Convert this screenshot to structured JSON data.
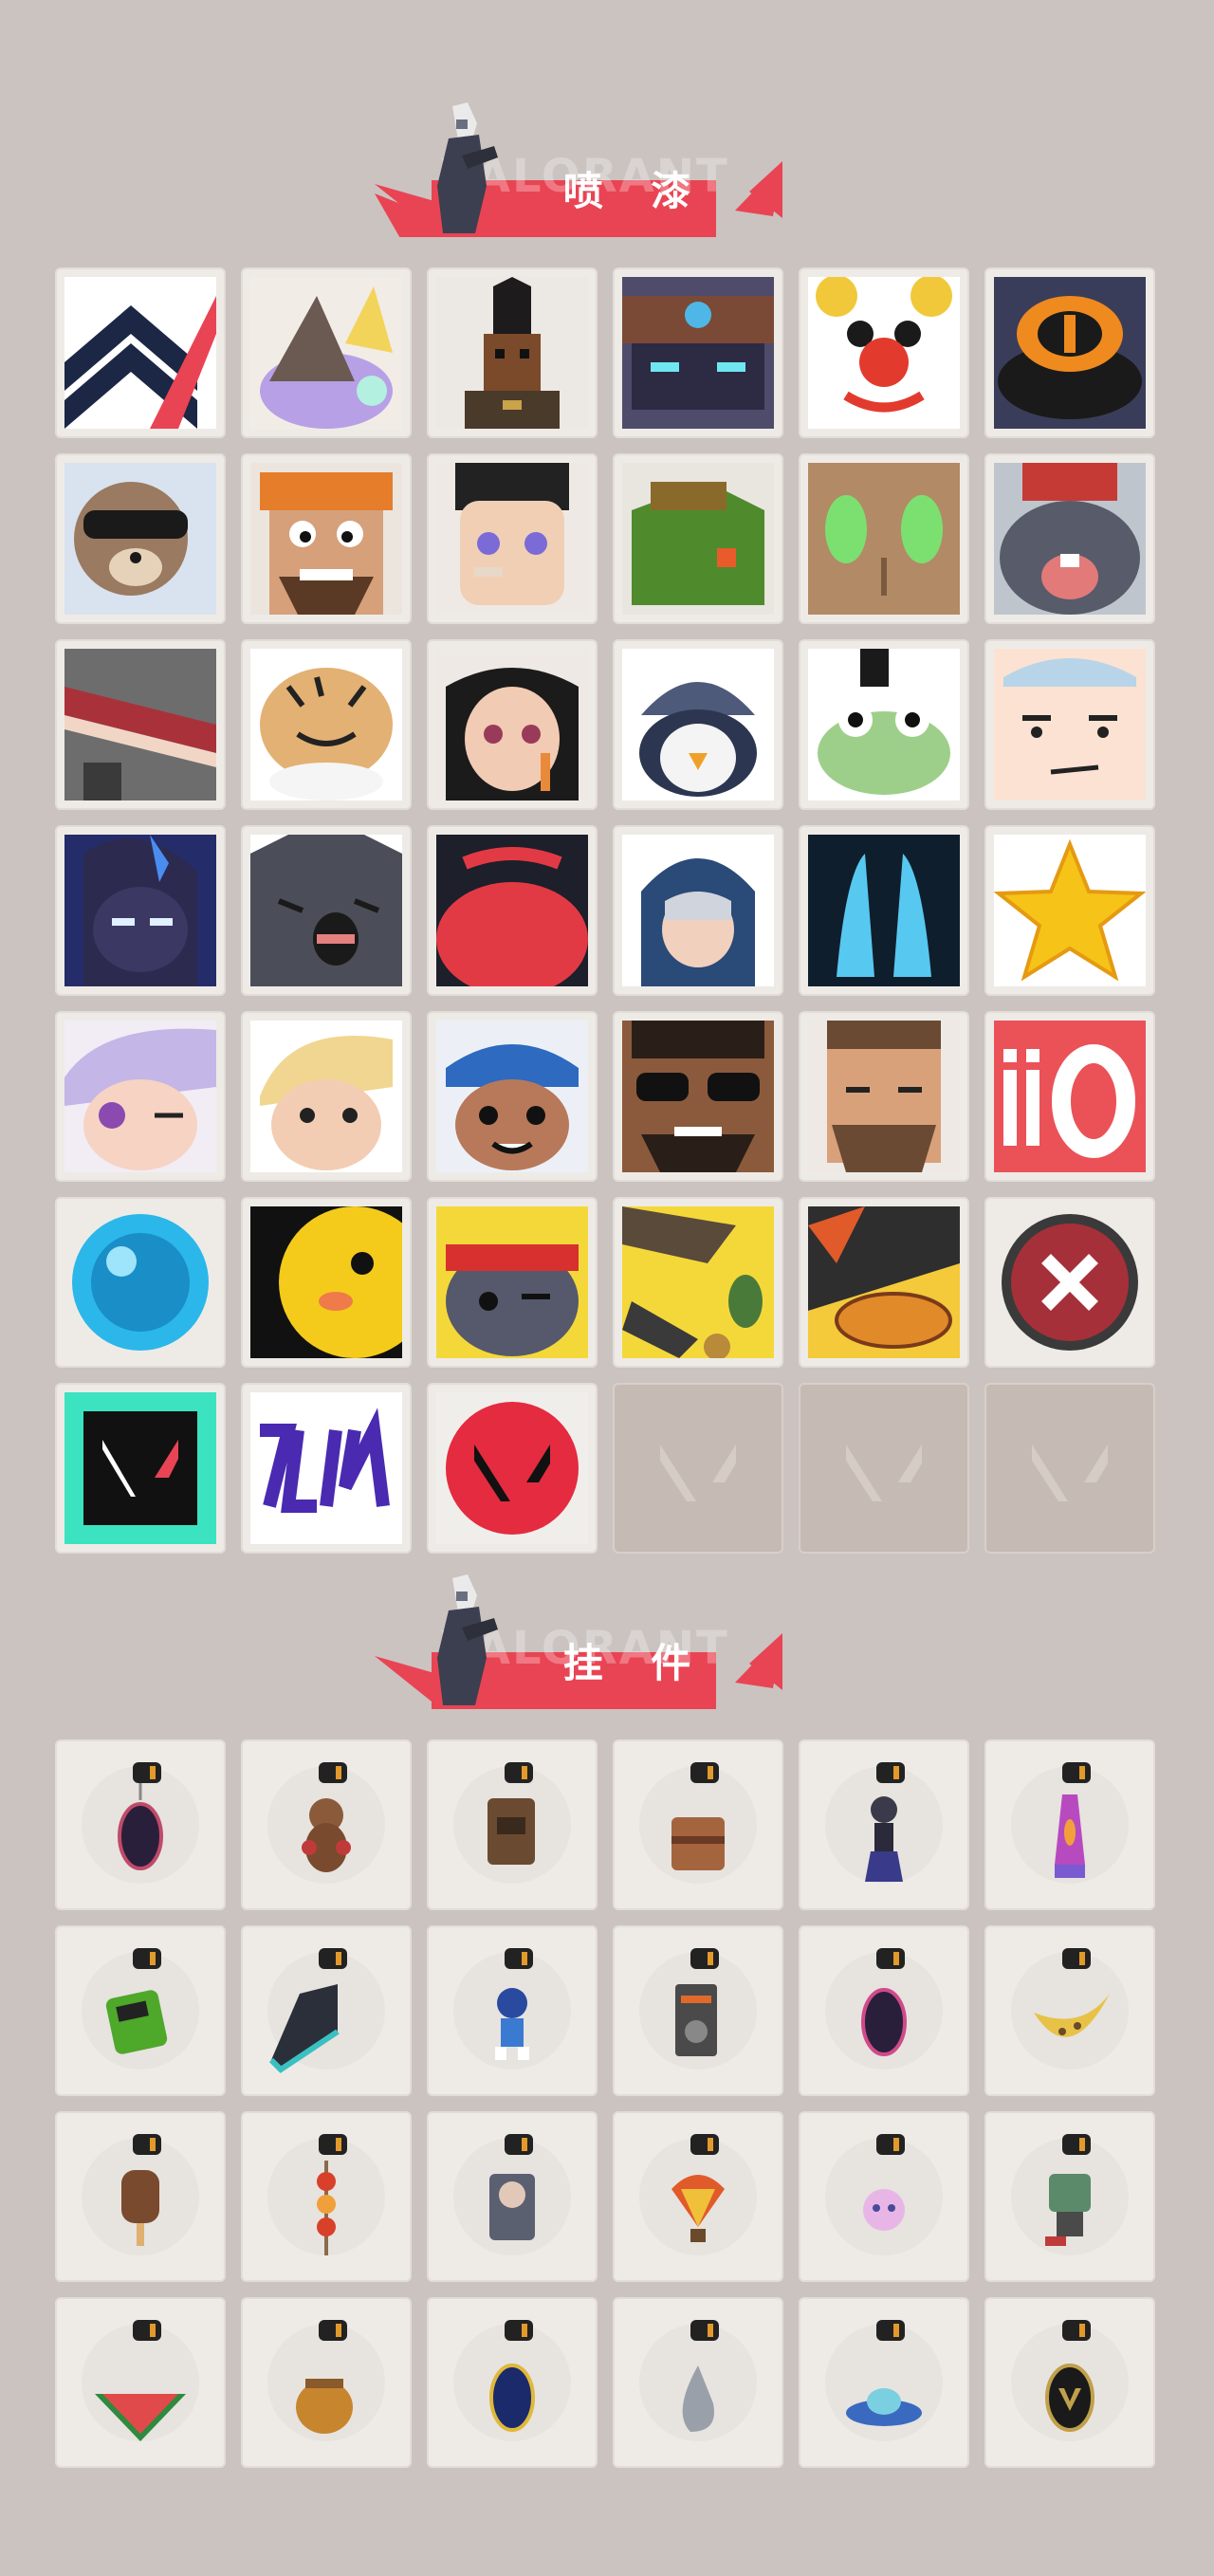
{
  "sections": [
    {
      "title": "喷 漆",
      "watermark": "VALORANT"
    },
    {
      "title": "挂 件",
      "watermark": "VALORANT"
    }
  ],
  "colors": {
    "background": "#cbc3c0",
    "accent": "#e94454",
    "tile": "#eeebe7",
    "empty_tile": "#c5bbb4"
  },
  "sprays": [
    "spray-chevron",
    "spray-horned-cat",
    "spray-pixel-agent",
    "spray-armored-robot",
    "spray-clown",
    "spray-orange-hat",
    "spray-raccoon-sunglasses",
    "spray-bearded-grin",
    "spray-bandaged-boy",
    "spray-green-crate",
    "spray-green-eyes",
    "spray-crying-creature",
    "spray-cake-slice",
    "spray-tiger",
    "spray-girl-pencil",
    "spray-penguin-beanie",
    "spray-frog-hat",
    "spray-smirk-face",
    "spray-shadow-agent",
    "spray-grey-blob",
    "spray-red-mouth",
    "spray-hooded-agent",
    "spray-blue-shape",
    "spray-gold-star",
    "spray-wink-girl",
    "spray-blonde-guy",
    "spray-blue-hat-girl",
    "spray-sunglasses-beard",
    "spray-bearded-man",
    "spray-ii0",
    "spray-blue-orb",
    "spray-yellow-bird",
    "spray-red-bandana",
    "spray-gun-collage",
    "spray-duck-beak",
    "spray-x-badge",
    "spray-v-splatter",
    "spray-purple-tag",
    "spray-red-v-logo",
    "empty",
    "empty",
    "empty"
  ],
  "charms": [
    "charm-ep9-medal",
    "charm-bear",
    "charm-bag",
    "charm-crate",
    "charm-agent-figure",
    "charm-lava-lamp",
    "charm-game-device",
    "charm-sneaker",
    "charm-astronaut",
    "charm-radio",
    "charm-ep9-medal-2",
    "charm-banana",
    "charm-popsicle",
    "charm-kebab",
    "charm-figure-grey",
    "charm-balloon",
    "charm-pink-figure",
    "charm-robot",
    "charm-watermelon",
    "charm-honey-pot",
    "charm-ep9-medal-3",
    "charm-silver-drop",
    "charm-ufo",
    "charm-gold-v"
  ]
}
